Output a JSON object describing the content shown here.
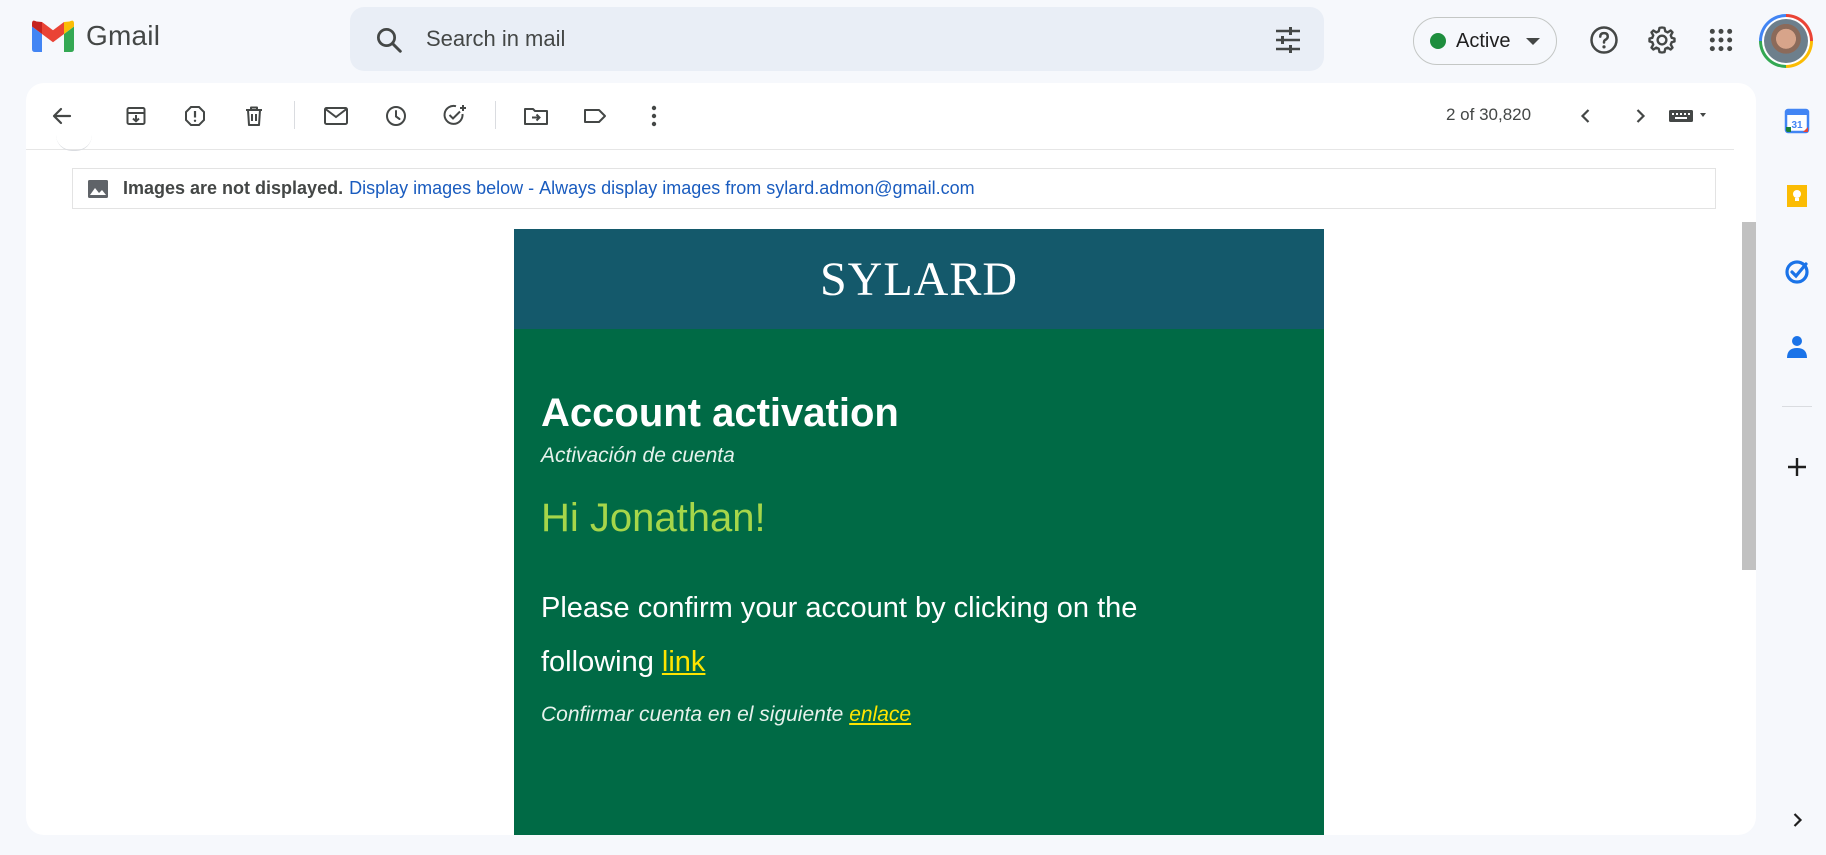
{
  "app": {
    "name": "Gmail"
  },
  "search": {
    "placeholder": "Search in mail"
  },
  "status": {
    "label": "Active",
    "color": "#1e8e3e"
  },
  "toolbar": {
    "counter": "2 of 30,820"
  },
  "images_banner": {
    "notice": "Images are not displayed.",
    "display_below": "Display images below",
    "separator": " - ",
    "always_display": "Always display images from sylard.admon@gmail.com"
  },
  "email": {
    "brand": "SYLARD",
    "title": "Account activation",
    "subtitle": "Activación de cuenta",
    "greeting": "Hi Jonathan!",
    "message": "Please confirm your account by clicking on the following",
    "message_link": "link",
    "message_es": "Confirmar cuenta en el siguiente",
    "message_es_link": "enlace",
    "colors": {
      "header_bg": "#14596b",
      "body_bg": "#006a45",
      "greeting": "#a6d64a",
      "link": "#ffe500"
    }
  },
  "icons": {
    "calendar_day": "31"
  }
}
